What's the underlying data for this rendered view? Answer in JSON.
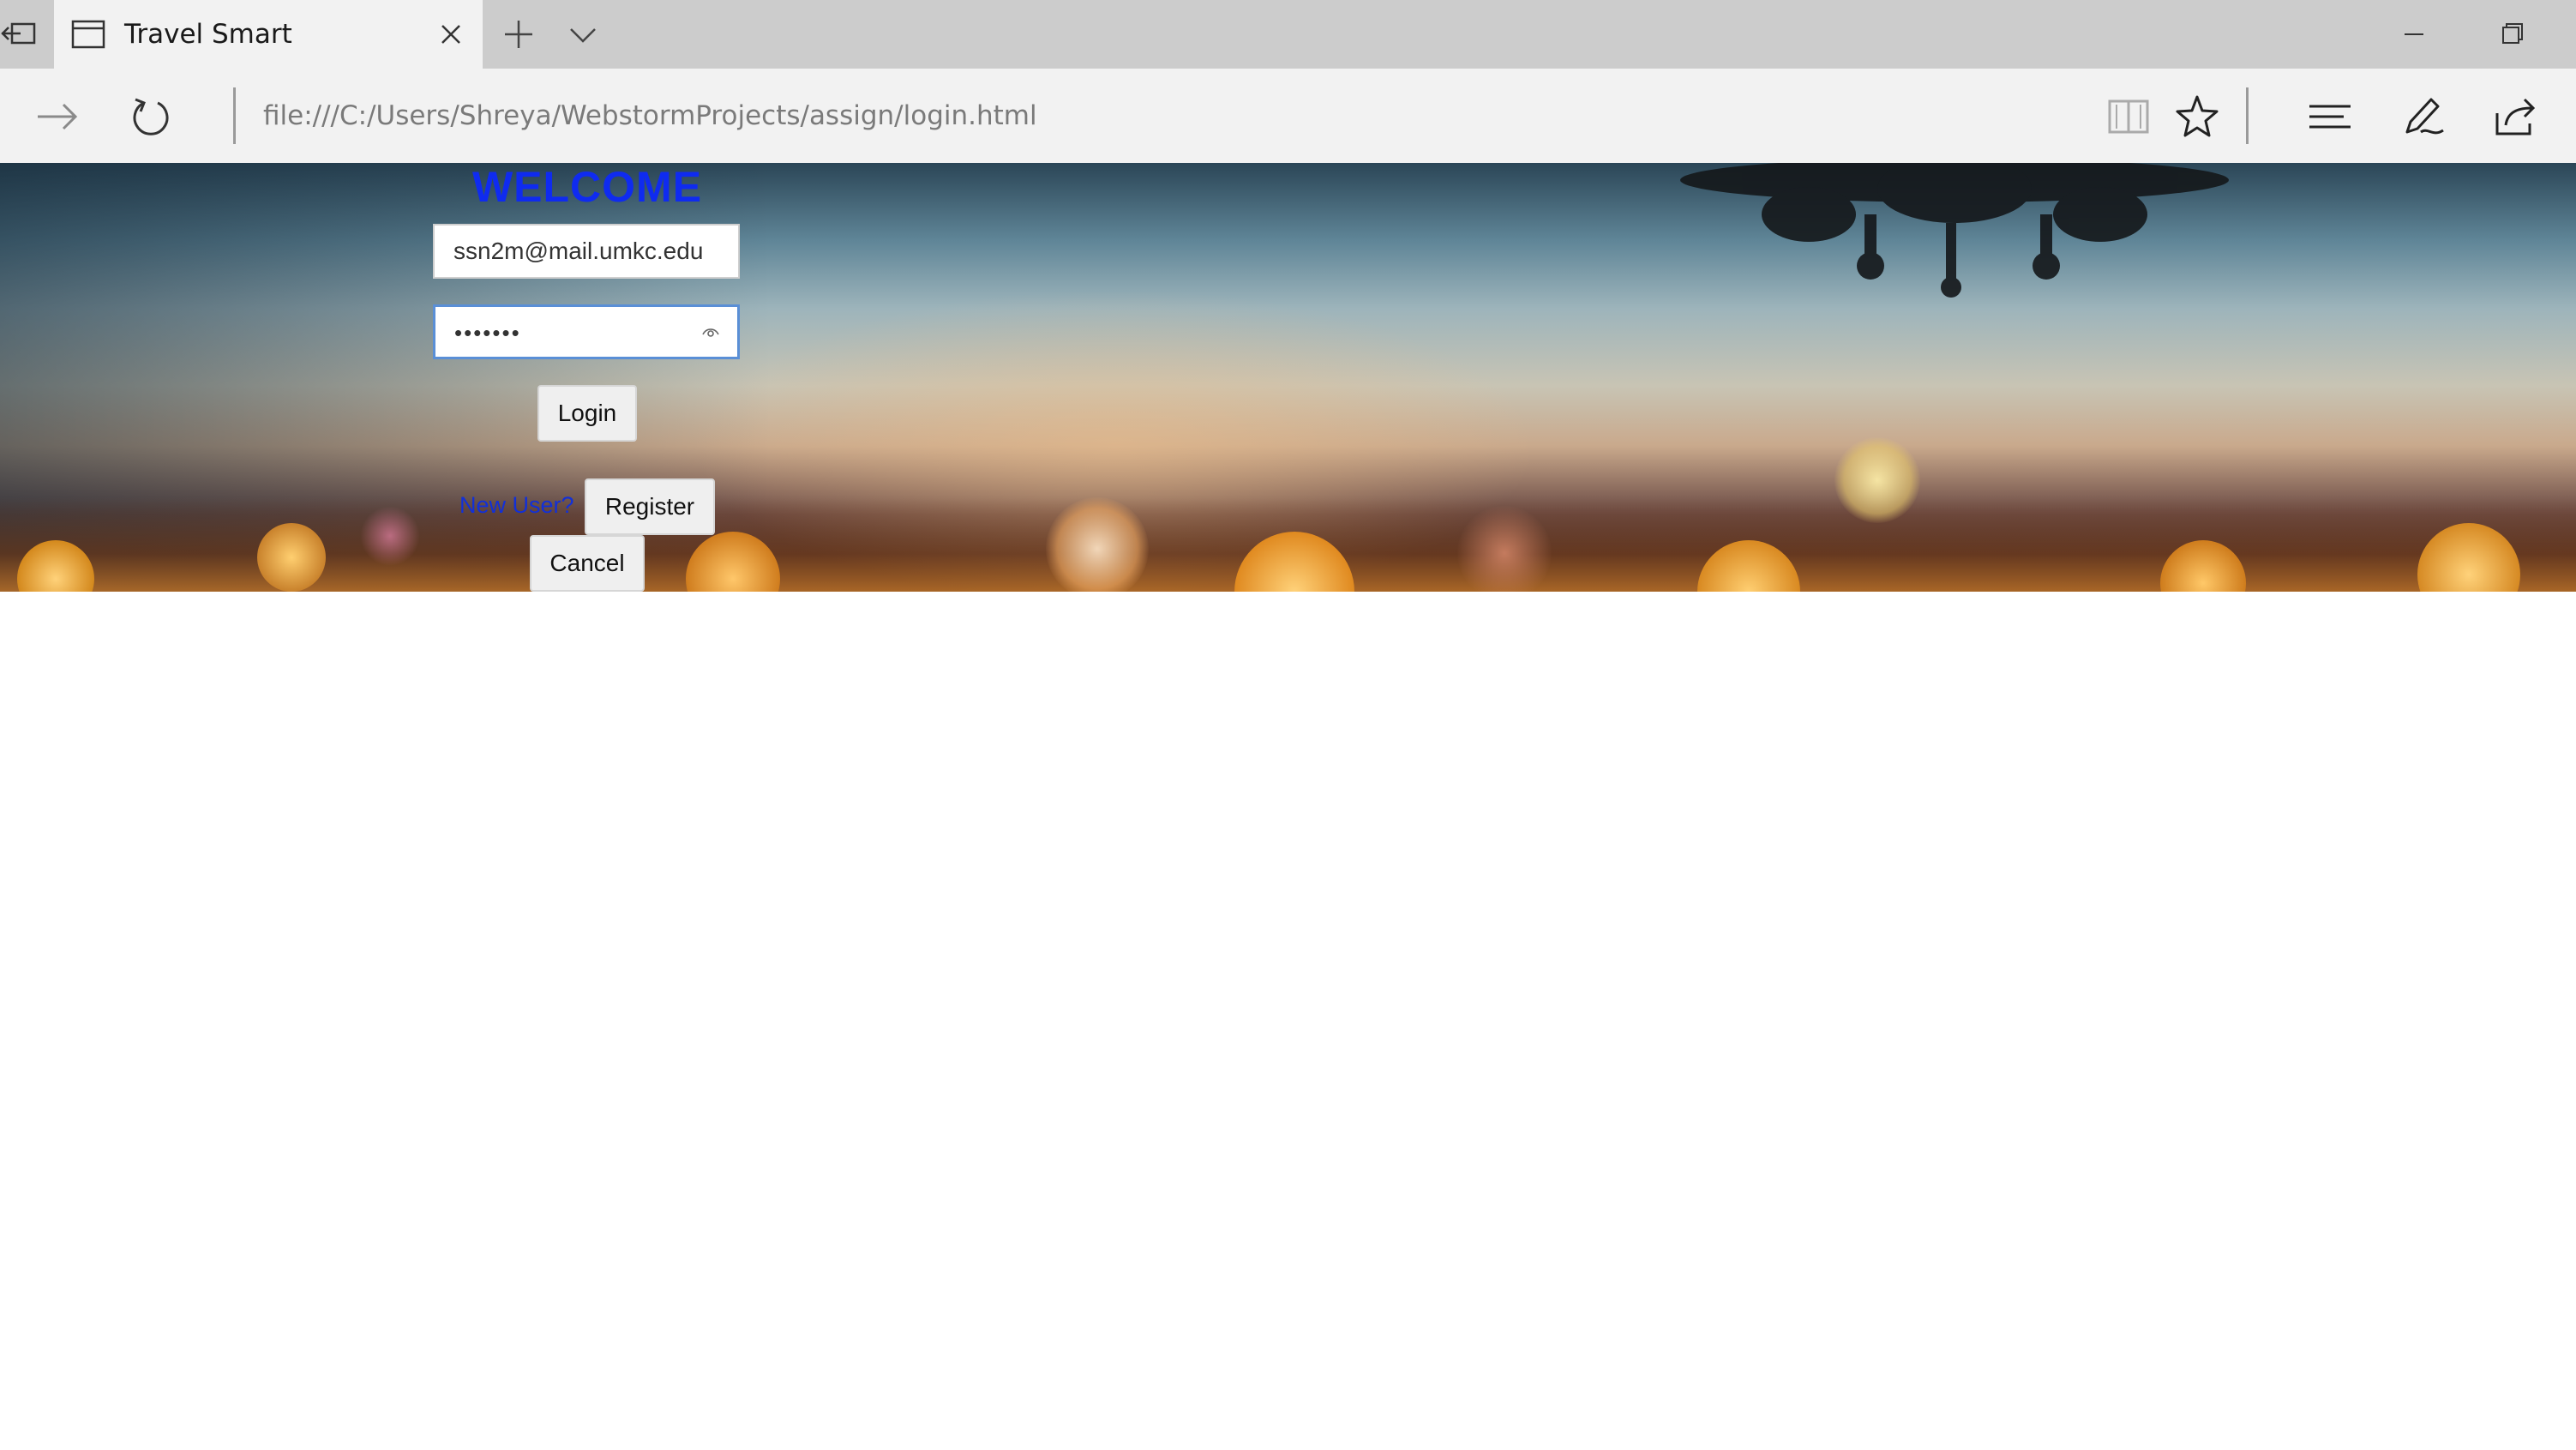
{
  "browser": {
    "tab_title": "Travel Smart",
    "address_url": "file:///C:/Users/Shreya/WebstormProjects/assign/login.html"
  },
  "page": {
    "welcome_heading": "WELCOME",
    "email_value": "ssn2m@mail.umkc.edu",
    "password_mask": "•••••••",
    "login_label": "Login",
    "new_user_text": "New User?",
    "register_label": "Register",
    "cancel_label": "Cancel"
  },
  "colors": {
    "welcome": "#0f2bf0",
    "link_blue": "#1230d8",
    "chrome_gray": "#cccccc",
    "toolbar_gray": "#f2f2f2"
  },
  "icons": {
    "tab_preview": "tab-preview-icon",
    "tab": "tab-page-icon",
    "close": "close-icon",
    "new_tab": "plus-icon",
    "tab_list": "chevron-down-icon",
    "minimize": "minimize-icon",
    "restore": "restore-icon",
    "forward": "arrow-right-icon",
    "refresh": "refresh-icon",
    "reading_view": "book-icon",
    "favorite": "star-icon",
    "hub": "hub-icon",
    "web_note": "pen-icon",
    "share": "share-icon",
    "reveal_password": "eye-icon"
  }
}
